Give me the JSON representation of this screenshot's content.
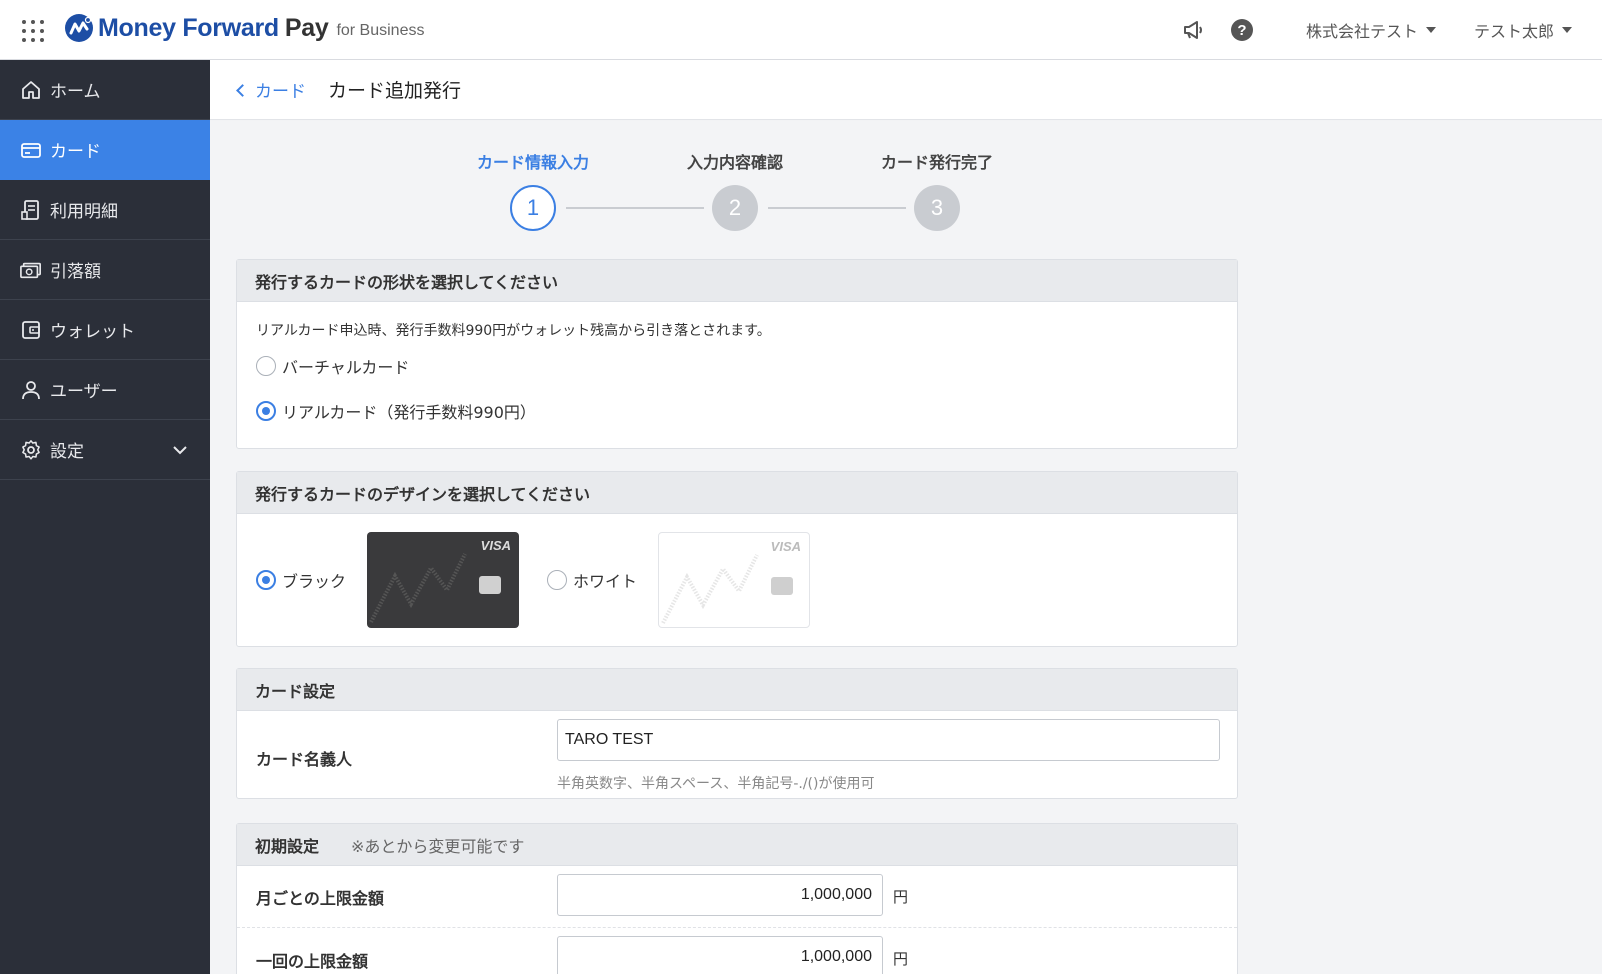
{
  "header": {
    "logo_brand": "Money Forward",
    "logo_pay": "Pay",
    "logo_sub": "for Business",
    "company": "株式会社テスト",
    "user": "テスト太郎",
    "help_glyph": "?"
  },
  "sidebar": {
    "items": [
      {
        "label": "ホーム",
        "icon": "home-icon"
      },
      {
        "label": "カード",
        "icon": "card-icon",
        "active": true
      },
      {
        "label": "利用明細",
        "icon": "statement-icon"
      },
      {
        "label": "引落額",
        "icon": "money-icon"
      },
      {
        "label": "ウォレット",
        "icon": "wallet-icon"
      },
      {
        "label": "ユーザー",
        "icon": "user-icon"
      },
      {
        "label": "設定",
        "icon": "gear-icon"
      }
    ]
  },
  "page": {
    "back_label": "カード",
    "title": "カード追加発行"
  },
  "stepper": {
    "steps": [
      {
        "label": "カード情報入力",
        "number": "1",
        "state": "active"
      },
      {
        "label": "入力内容確認",
        "number": "2",
        "state": "todo"
      },
      {
        "label": "カード発行完了",
        "number": "3",
        "state": "todo"
      }
    ]
  },
  "card_type": {
    "heading": "発行するカードの形状を選択してください",
    "note": "リアルカード申込時、発行手数料990円がウォレット残高から引き落とされます。",
    "options": [
      {
        "label": "バーチャルカード",
        "selected": false
      },
      {
        "label": "リアルカード（発行手数料990円）",
        "selected": true
      }
    ]
  },
  "card_design": {
    "heading": "発行するカードのデザインを選択してください",
    "options": [
      {
        "label": "ブラック",
        "selected": true
      },
      {
        "label": "ホワイト",
        "selected": false
      }
    ],
    "card_brand": "VISA"
  },
  "card_settings": {
    "heading": "カード設定",
    "holder_label": "カード名義人",
    "holder_value": "TARO TEST",
    "holder_hint": "半角英数字、半角スペース、半角記号-./()が使用可"
  },
  "initial_settings": {
    "heading": "初期設定",
    "heading_note": "※あとから変更可能です",
    "monthly_label": "月ごとの上限金額",
    "monthly_value": "1,000,000",
    "per_use_label": "一回の上限金額",
    "per_use_value": "1,000,000",
    "unit": "円"
  },
  "colors": {
    "accent": "#3b7fe3",
    "sidebar_bg": "#2b2f39",
    "sidebar_active": "#3b82e6",
    "brand": "#1d4ea5"
  }
}
